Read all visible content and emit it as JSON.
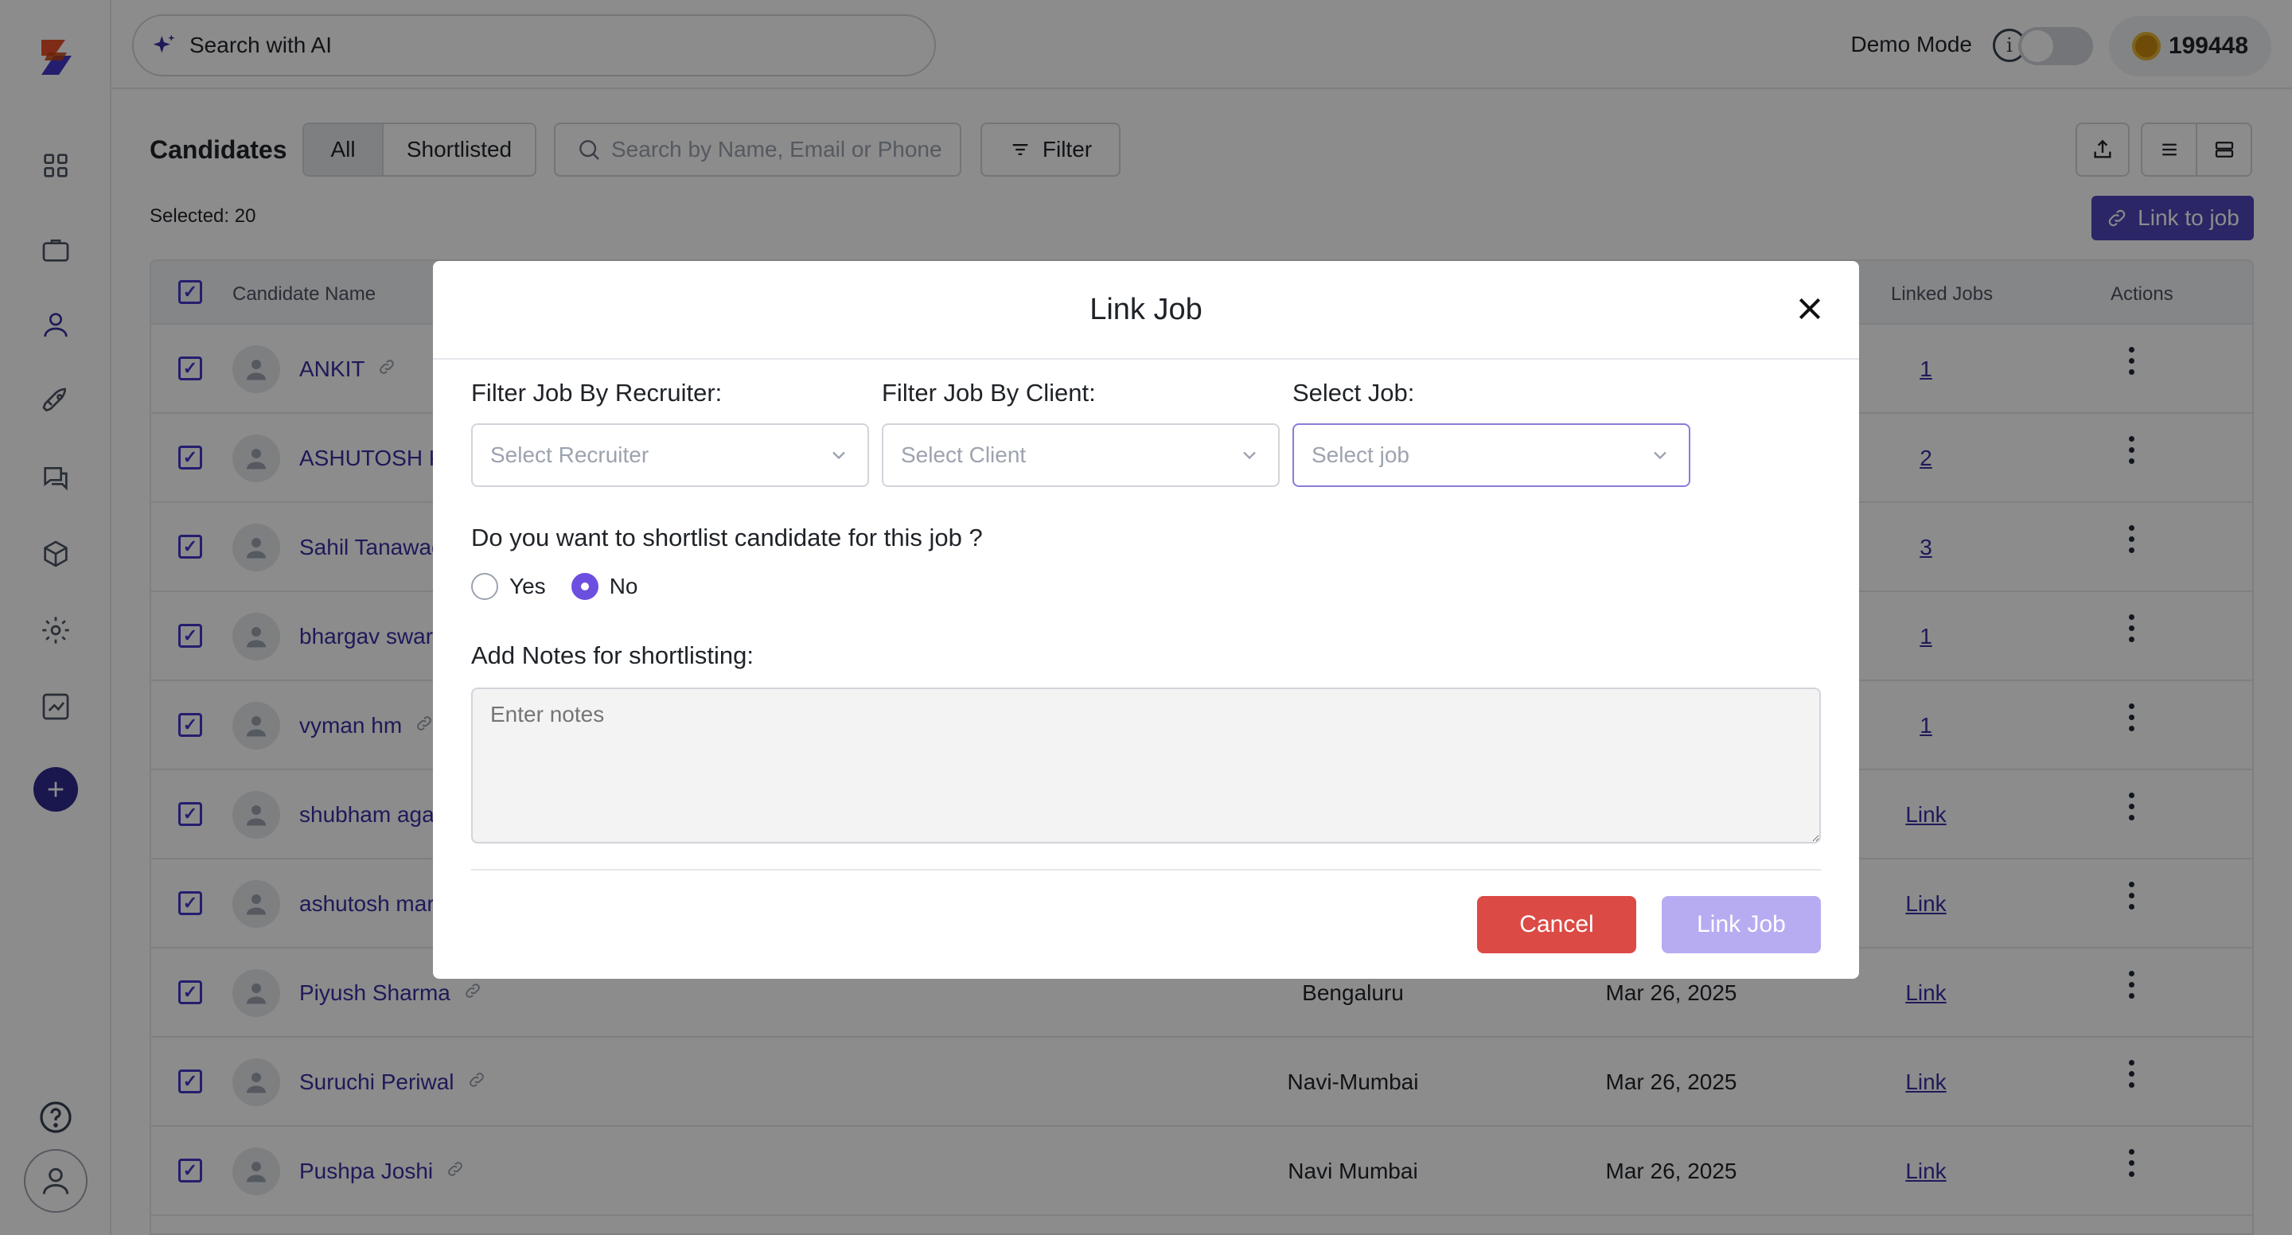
{
  "topbar": {
    "ai_search_label": "Search with AI",
    "demo_mode_label": "Demo Mode",
    "info_glyph": "i",
    "coin_balance": "199448"
  },
  "page": {
    "title": "Candidates",
    "tabs": [
      "All",
      "Shortlisted"
    ],
    "search_placeholder": "Search by Name, Email or Phone",
    "filter_label": "Filter",
    "selected_text": "Selected: 20",
    "link_to_job_label": "Link to job"
  },
  "table": {
    "headers": {
      "candidate_name": "Candidate Name",
      "linked_jobs": "Linked Jobs",
      "actions": "Actions"
    },
    "rows": [
      {
        "name": "ANKIT",
        "location": "",
        "date": "",
        "linked": "1"
      },
      {
        "name": "ASHUTOSH K",
        "location": "",
        "date": "",
        "linked": "2"
      },
      {
        "name": "Sahil Tanawad",
        "location": "",
        "date": "",
        "linked": "3"
      },
      {
        "name": "bhargav swar",
        "location": "",
        "date": "",
        "linked": "1"
      },
      {
        "name": "vyman hm",
        "location": "",
        "date": "",
        "linked": "1"
      },
      {
        "name": "shubham aga",
        "location": "",
        "date": "",
        "linked": "Link"
      },
      {
        "name": "ashutosh mar",
        "location": "",
        "date": "",
        "linked": "Link"
      },
      {
        "name": "Piyush Sharma",
        "location": "Bengaluru",
        "date": "Mar 26, 2025",
        "linked": "Link"
      },
      {
        "name": "Suruchi Periwal",
        "location": "Navi-Mumbai",
        "date": "Mar 26, 2025",
        "linked": "Link"
      },
      {
        "name": "Pushpa Joshi",
        "location": "Navi Mumbai",
        "date": "Mar 26, 2025",
        "linked": "Link"
      }
    ]
  },
  "modal": {
    "title": "Link Job",
    "recruiter_label": "Filter Job By Recruiter:",
    "recruiter_placeholder": "Select Recruiter",
    "client_label": "Filter Job By Client:",
    "client_placeholder": "Select Client",
    "job_label": "Select Job:",
    "job_placeholder": "Select job",
    "question": "Do you want to shortlist candidate for this job ?",
    "yes_label": "Yes",
    "no_label": "No",
    "selected_option": "No",
    "notes_label": "Add Notes for shortlisting:",
    "notes_placeholder": "Enter notes",
    "cancel_label": "Cancel",
    "submit_label": "Link Job"
  },
  "colors": {
    "brand": "#2f2a8f",
    "accent": "#4f46b8",
    "cancel": "#dc4a45",
    "link_disabled": "#b7acf2"
  }
}
